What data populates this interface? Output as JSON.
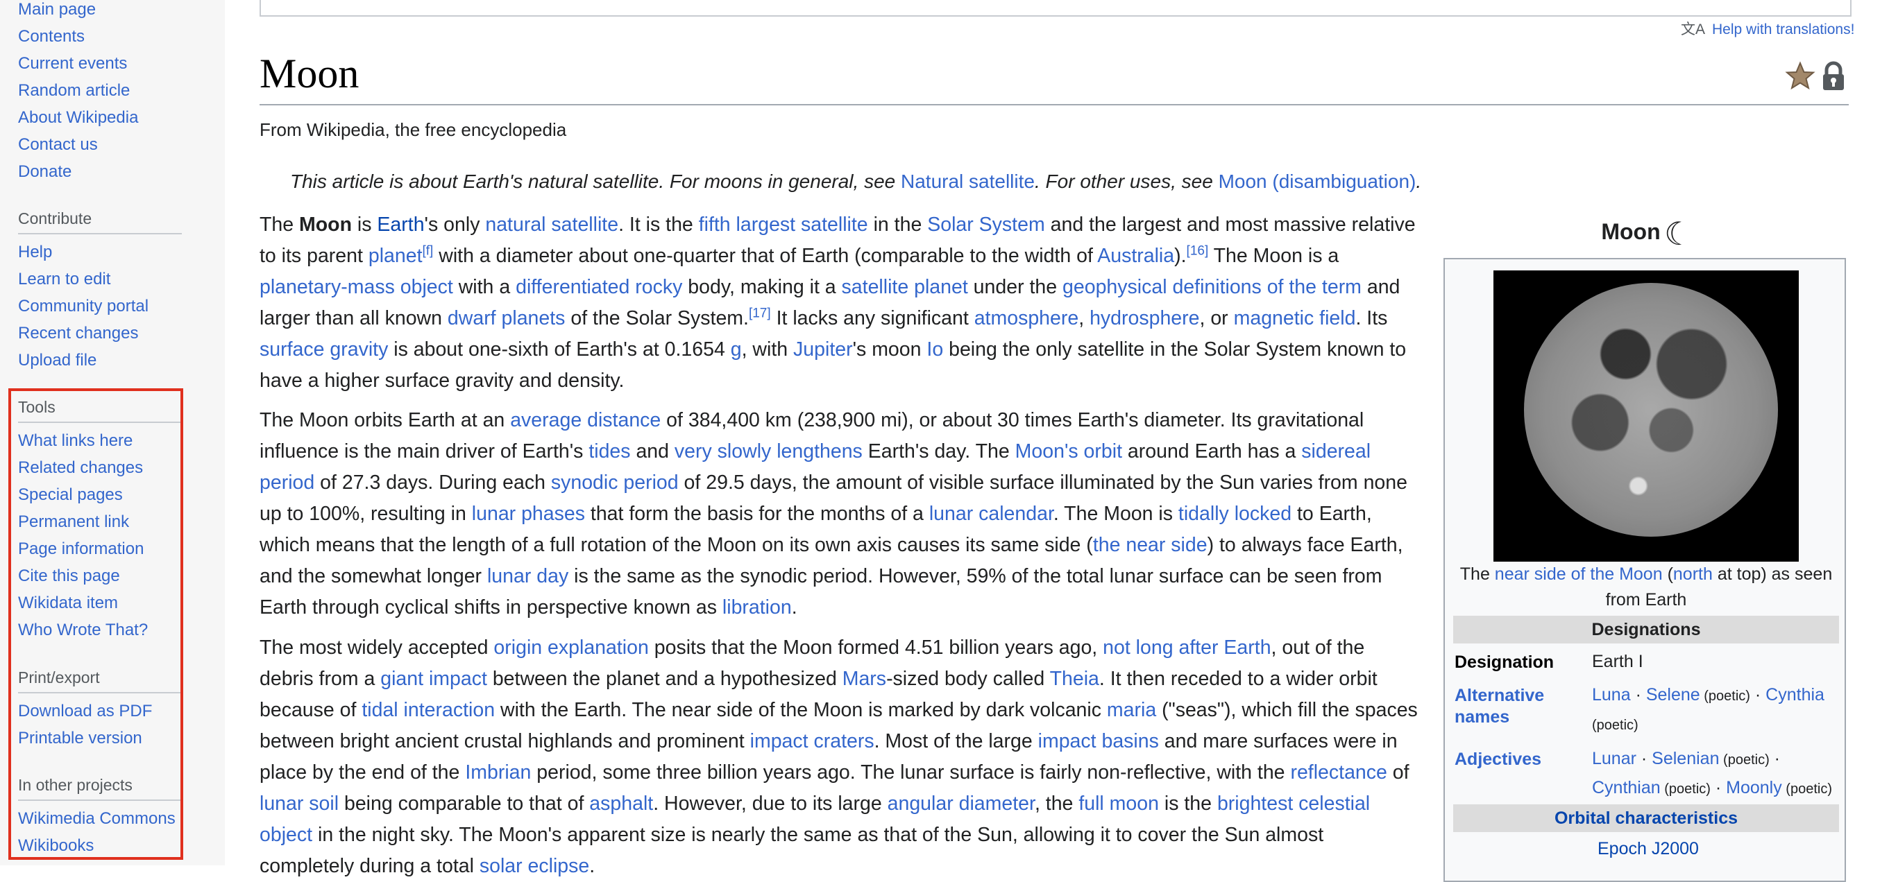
{
  "sidebar": {
    "navigation": [
      "Main page",
      "Contents",
      "Current events",
      "Random article",
      "About Wikipedia",
      "Contact us",
      "Donate"
    ],
    "contribute_heading": "Contribute",
    "contribute": [
      "Help",
      "Learn to edit",
      "Community portal",
      "Recent changes",
      "Upload file"
    ],
    "tools_heading": "Tools",
    "tools": [
      "What links here",
      "Related changes",
      "Special pages",
      "Permanent link",
      "Page information",
      "Cite this page",
      "Wikidata item",
      "Who Wrote That?"
    ],
    "print_heading": "Print/export",
    "print": [
      "Download as PDF",
      "Printable version"
    ],
    "projects_heading": "In other projects",
    "projects": [
      "Wikimedia Commons",
      "Wikibooks"
    ],
    "highlight_color": "#e0301e"
  },
  "header": {
    "translate_help": "Help with translations!",
    "title": "Moon",
    "tagline": "From Wikipedia, the free encyclopedia"
  },
  "hatnote": {
    "pre": "This article is about Earth's natural satellite. For moons in general, see ",
    "link1": "Natural satellite",
    "mid": ". For other uses, see ",
    "link2": "Moon (disambiguation)",
    "post": "."
  },
  "article": {
    "p1": [
      [
        "t",
        "The "
      ],
      [
        "b",
        "Moon"
      ],
      [
        "t",
        " is "
      ],
      [
        "d",
        "Earth"
      ],
      [
        "t",
        "'s only "
      ],
      [
        "l",
        "natural satellite"
      ],
      [
        "t",
        ". It is the "
      ],
      [
        "l",
        "fifth largest satellite"
      ],
      [
        "t",
        " in the "
      ],
      [
        "l",
        "Solar System"
      ],
      [
        "t",
        " and the largest and most massive relative to its parent "
      ],
      [
        "l",
        "planet"
      ],
      [
        "s",
        "[f]"
      ],
      [
        "t",
        " with a diameter about one-quarter that of Earth (comparable to the width of "
      ],
      [
        "l",
        "Australia"
      ],
      [
        "t",
        ")."
      ],
      [
        "s",
        "[16]"
      ],
      [
        "t",
        " The Moon is a "
      ],
      [
        "l",
        "planetary-mass object"
      ],
      [
        "t",
        " with a "
      ],
      [
        "l",
        "differentiated rocky"
      ],
      [
        "t",
        " body, making it a "
      ],
      [
        "l",
        "satellite planet"
      ],
      [
        "t",
        " under the "
      ],
      [
        "l",
        "geophysical definitions of the term"
      ],
      [
        "t",
        " and larger than all known "
      ],
      [
        "l",
        "dwarf planets"
      ],
      [
        "t",
        " of the Solar System."
      ],
      [
        "s",
        "[17]"
      ],
      [
        "t",
        " It lacks any significant "
      ],
      [
        "l",
        "atmosphere"
      ],
      [
        "t",
        ", "
      ],
      [
        "l",
        "hydrosphere"
      ],
      [
        "t",
        ", or "
      ],
      [
        "l",
        "magnetic field"
      ],
      [
        "t",
        ". Its "
      ],
      [
        "l",
        "surface gravity"
      ],
      [
        "t",
        " is about one-sixth of Earth's at 0.1654 "
      ],
      [
        "l",
        "g"
      ],
      [
        "t",
        ", with "
      ],
      [
        "l",
        "Jupiter"
      ],
      [
        "t",
        "'s moon "
      ],
      [
        "l",
        "Io"
      ],
      [
        "t",
        " being the only satellite in the Solar System known to have a higher surface gravity and density."
      ]
    ],
    "p2": [
      [
        "t",
        "The Moon orbits Earth at an "
      ],
      [
        "l",
        "average distance"
      ],
      [
        "t",
        " of 384,400 km (238,900 mi), or about 30 times Earth's diameter. Its gravitational influence is the main driver of Earth's "
      ],
      [
        "l",
        "tides"
      ],
      [
        "t",
        " and "
      ],
      [
        "l",
        "very slowly lengthens"
      ],
      [
        "t",
        " Earth's day. The "
      ],
      [
        "l",
        "Moon's orbit"
      ],
      [
        "t",
        " around Earth has a "
      ],
      [
        "l",
        "sidereal period"
      ],
      [
        "t",
        " of 27.3 days. During each "
      ],
      [
        "l",
        "synodic period"
      ],
      [
        "t",
        " of 29.5 days, the amount of visible surface illuminated by the Sun varies from none up to 100%, resulting in "
      ],
      [
        "l",
        "lunar phases"
      ],
      [
        "t",
        " that form the basis for the months of a "
      ],
      [
        "l",
        "lunar calendar"
      ],
      [
        "t",
        ". The Moon is "
      ],
      [
        "l",
        "tidally locked"
      ],
      [
        "t",
        " to Earth, which means that the length of a full rotation of the Moon on its own axis causes its same side ("
      ],
      [
        "l",
        "the near side"
      ],
      [
        "t",
        ") to always face Earth, and the somewhat longer "
      ],
      [
        "l",
        "lunar day"
      ],
      [
        "t",
        " is the same as the synodic period. However, 59% of the total lunar surface can be seen from Earth through cyclical shifts in perspective known as "
      ],
      [
        "l",
        "libration"
      ],
      [
        "t",
        "."
      ]
    ],
    "p3": [
      [
        "t",
        "The most widely accepted "
      ],
      [
        "l",
        "origin explanation"
      ],
      [
        "t",
        " posits that the Moon formed 4.51 billion years ago, "
      ],
      [
        "l",
        "not long after Earth"
      ],
      [
        "t",
        ", out of the debris from a "
      ],
      [
        "l",
        "giant impact"
      ],
      [
        "t",
        " between the planet and a hypothesized "
      ],
      [
        "l",
        "Mars"
      ],
      [
        "t",
        "-sized body called "
      ],
      [
        "l",
        "Theia"
      ],
      [
        "t",
        ". It then receded to a wider orbit because of "
      ],
      [
        "l",
        "tidal interaction"
      ],
      [
        "t",
        " with the Earth. The near side of the Moon is marked by dark volcanic "
      ],
      [
        "l",
        "maria"
      ],
      [
        "t",
        " (\"seas\"), which fill the spaces between bright ancient crustal highlands and prominent "
      ],
      [
        "l",
        "impact craters"
      ],
      [
        "t",
        ". Most of the large "
      ],
      [
        "l",
        "impact basins"
      ],
      [
        "t",
        " and mare surfaces were in place by the end of the "
      ],
      [
        "l",
        "Imbrian"
      ],
      [
        "t",
        " period, some three billion years ago. The lunar surface is fairly non-reflective, with the "
      ],
      [
        "l",
        "reflectance"
      ],
      [
        "t",
        " of "
      ],
      [
        "l",
        "lunar soil"
      ],
      [
        "t",
        " being comparable to that of "
      ],
      [
        "l",
        "asphalt"
      ],
      [
        "t",
        ". However, due to its large "
      ],
      [
        "l",
        "angular diameter"
      ],
      [
        "t",
        ", the "
      ],
      [
        "l",
        "full moon"
      ],
      [
        "t",
        " is the "
      ],
      [
        "l",
        "brightest celestial object"
      ],
      [
        "t",
        " in the night sky. The Moon's apparent size is nearly the same as that of the Sun, allowing it to cover the Sun almost completely during a total "
      ],
      [
        "l",
        "solar eclipse"
      ],
      [
        "t",
        "."
      ]
    ]
  },
  "infobox": {
    "title": "Moon",
    "title_symbol": "☾",
    "caption": [
      [
        "t",
        "The "
      ],
      [
        "l",
        "near side of the Moon"
      ],
      [
        "t",
        " ("
      ],
      [
        "l",
        "north"
      ],
      [
        "t",
        " at top) as seen from Earth"
      ]
    ],
    "designations_header": "Designations",
    "designation_label": "Designation",
    "designation_value": "Earth I",
    "alt_names_label": "Alternative names",
    "alt_names": [
      [
        "l",
        "Luna"
      ],
      [
        "t",
        " · "
      ],
      [
        "l",
        "Selene"
      ],
      [
        "m",
        " (poetic)"
      ],
      [
        "t",
        " · "
      ],
      [
        "l",
        "Cynthia"
      ],
      [
        "m",
        " (poetic)"
      ]
    ],
    "adjectives_label": "Adjectives",
    "adjectives": [
      [
        "l",
        "Lunar"
      ],
      [
        "t",
        " · "
      ],
      [
        "l",
        "Selenian"
      ],
      [
        "m",
        " (poetic)"
      ],
      [
        "t",
        " · "
      ],
      [
        "l",
        "Cynthian"
      ],
      [
        "m",
        " (poetic)"
      ],
      [
        "t",
        " · "
      ],
      [
        "l",
        "Moonly"
      ],
      [
        "m",
        " (poetic)"
      ]
    ],
    "orbital_header": "Orbital characteristics",
    "epoch": "Epoch J2000"
  }
}
